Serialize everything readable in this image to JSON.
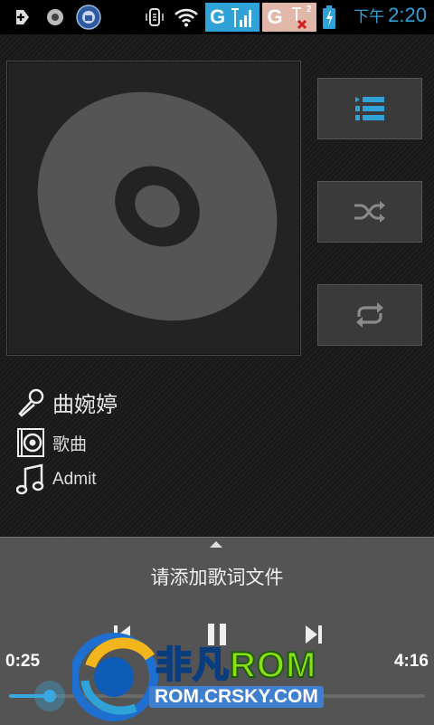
{
  "status_bar": {
    "icons": [
      "add-icon",
      "sync-icon",
      "app-badge-icon",
      "vibrate-icon",
      "wifi-icon",
      "sim1-signal-icon",
      "sim2-signal-icon",
      "battery-charging-icon"
    ],
    "sim1_label": "G",
    "sim2_label": "G",
    "sim2_badge": "2",
    "ampm": "下午",
    "time": "2:20",
    "accent_color": "#2fa3d8"
  },
  "player": {
    "side_buttons": [
      "playlist-icon",
      "shuffle-icon",
      "repeat-icon"
    ],
    "artist": "曲婉婷",
    "album": "歌曲",
    "track": "Admit"
  },
  "panel": {
    "lyrics_prompt": "请添加歌词文件",
    "elapsed": "0:25",
    "duration": "4:16",
    "progress_fraction": 0.098
  },
  "watermark": {
    "brand_cn": "非凡",
    "brand_rom": "ROM",
    "url": "ROM.CRSKY.COM"
  }
}
